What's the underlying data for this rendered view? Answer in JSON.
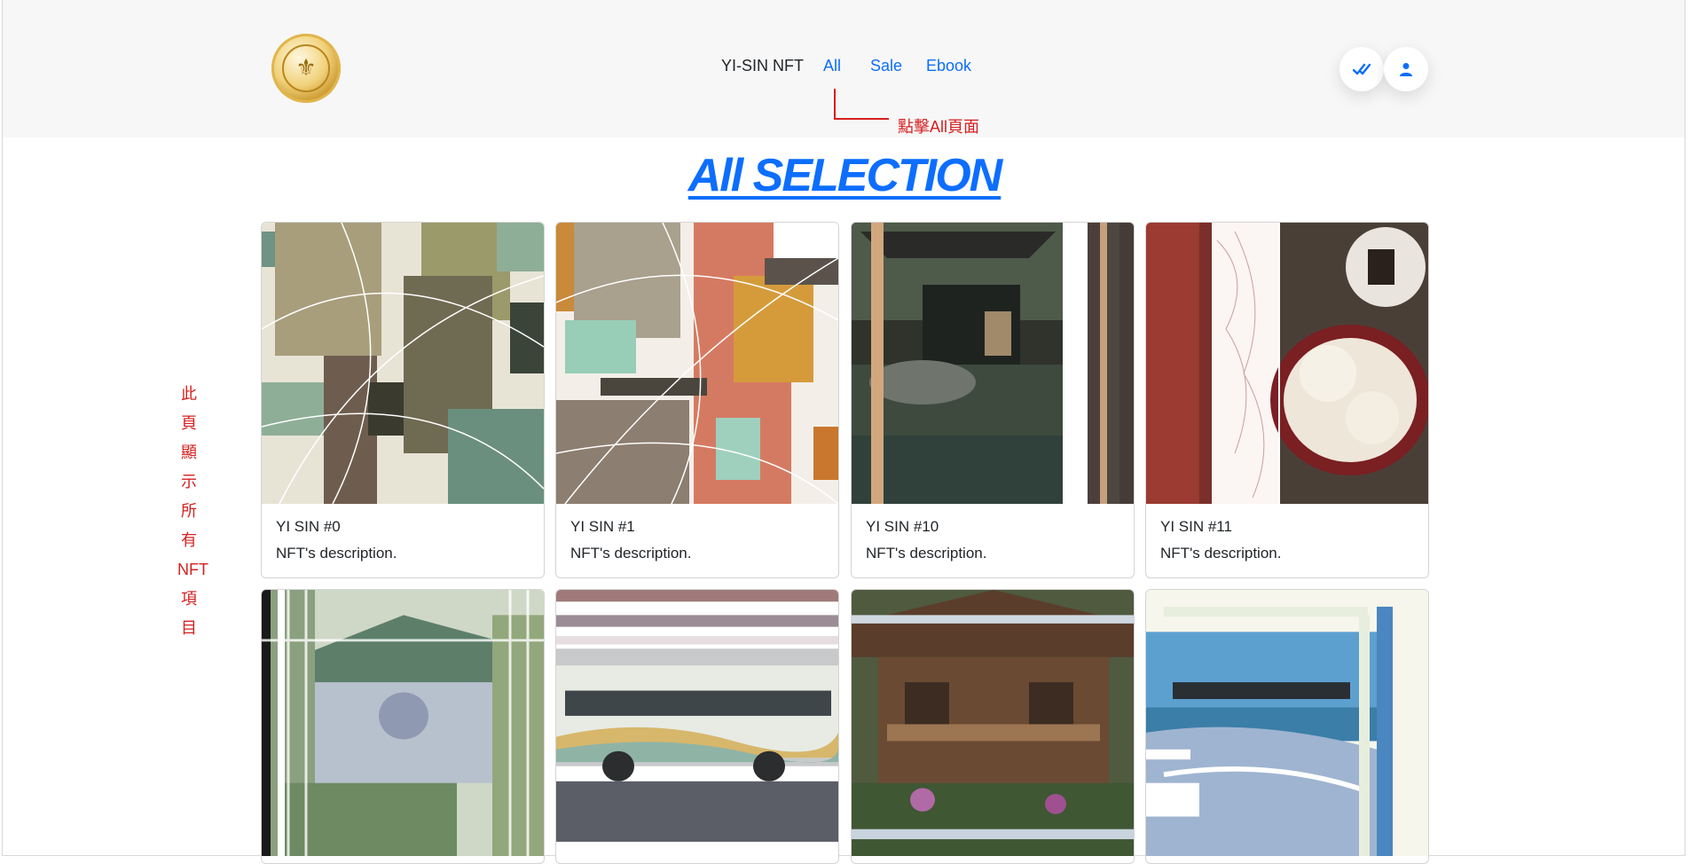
{
  "navbar": {
    "brand": "YI-SIN NFT",
    "links": [
      {
        "label": "All"
      },
      {
        "label": "Sale"
      },
      {
        "label": "Ebook"
      }
    ],
    "icons": [
      "double-check-icon",
      "user-icon"
    ]
  },
  "annotations": {
    "nav_note": "點擊All頁面",
    "side_note": [
      "此",
      "頁",
      "顯",
      "示",
      "所",
      "有",
      "NFT",
      "項",
      "目"
    ]
  },
  "page": {
    "heading": "All SELECTION"
  },
  "cards": [
    {
      "title": "YI SIN #0",
      "description": "NFT's description."
    },
    {
      "title": "YI SIN #1",
      "description": "NFT's description."
    },
    {
      "title": "YI SIN #10",
      "description": "NFT's description."
    },
    {
      "title": "YI SIN #11",
      "description": "NFT's description."
    },
    {
      "title": "",
      "description": ""
    },
    {
      "title": "",
      "description": ""
    },
    {
      "title": "",
      "description": ""
    },
    {
      "title": "",
      "description": ""
    }
  ],
  "colors": {
    "accent": "#0d6efd",
    "annotation": "#d61f1f",
    "navbar_bg": "#f7f7f7"
  }
}
